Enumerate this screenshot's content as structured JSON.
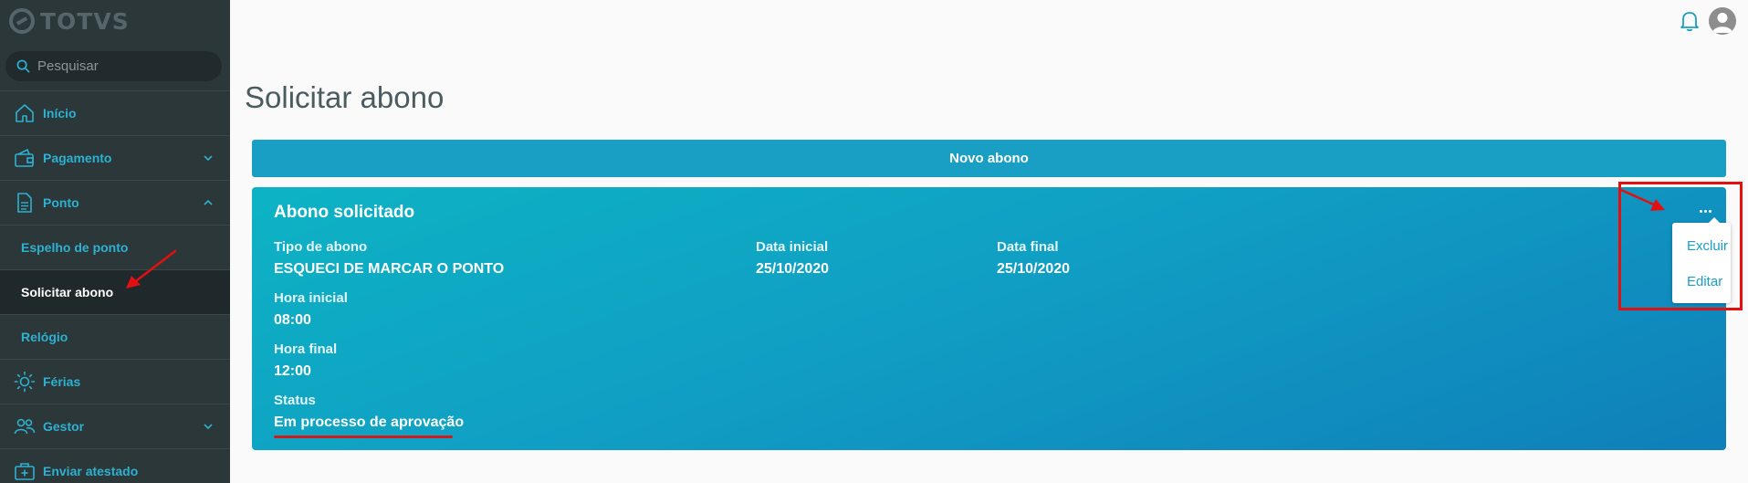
{
  "brand": {
    "name": "TOTVS"
  },
  "search": {
    "placeholder": "Pesquisar"
  },
  "sidebar": {
    "items": [
      {
        "label": "Início",
        "icon": "home-icon"
      },
      {
        "label": "Pagamento",
        "icon": "wallet-icon",
        "expanded": false
      },
      {
        "label": "Ponto",
        "icon": "document-icon",
        "expanded": true
      },
      {
        "label": "Férias",
        "icon": "sun-icon"
      },
      {
        "label": "Gestor",
        "icon": "users-icon",
        "expanded": false
      },
      {
        "label": "Enviar atestado",
        "icon": "medical-kit-icon"
      }
    ],
    "ponto_sub": [
      {
        "label": "Espelho de ponto",
        "active": false
      },
      {
        "label": "Solicitar abono",
        "active": true
      },
      {
        "label": "Relógio",
        "active": false
      }
    ]
  },
  "page": {
    "title": "Solicitar abono"
  },
  "new_button": {
    "label": "Novo abono"
  },
  "card": {
    "title": "Abono solicitado",
    "fields": {
      "tipo_label": "Tipo de abono",
      "tipo_value": "ESQUECI DE MARCAR O PONTO",
      "data_inicial_label": "Data inicial",
      "data_inicial_value": "25/10/2020",
      "data_final_label": "Data final",
      "data_final_value": "25/10/2020",
      "hora_inicial_label": "Hora inicial",
      "hora_inicial_value": "08:00",
      "hora_final_label": "Hora final",
      "hora_final_value": "12:00",
      "status_label": "Status",
      "status_value": "Em processo de aprovação"
    }
  },
  "actions_menu": {
    "excluir": "Excluir",
    "editar": "Editar"
  },
  "colors": {
    "accent": "#1a9fc4",
    "sidebar_bg": "#2c3739",
    "annotation": "#e41010"
  }
}
